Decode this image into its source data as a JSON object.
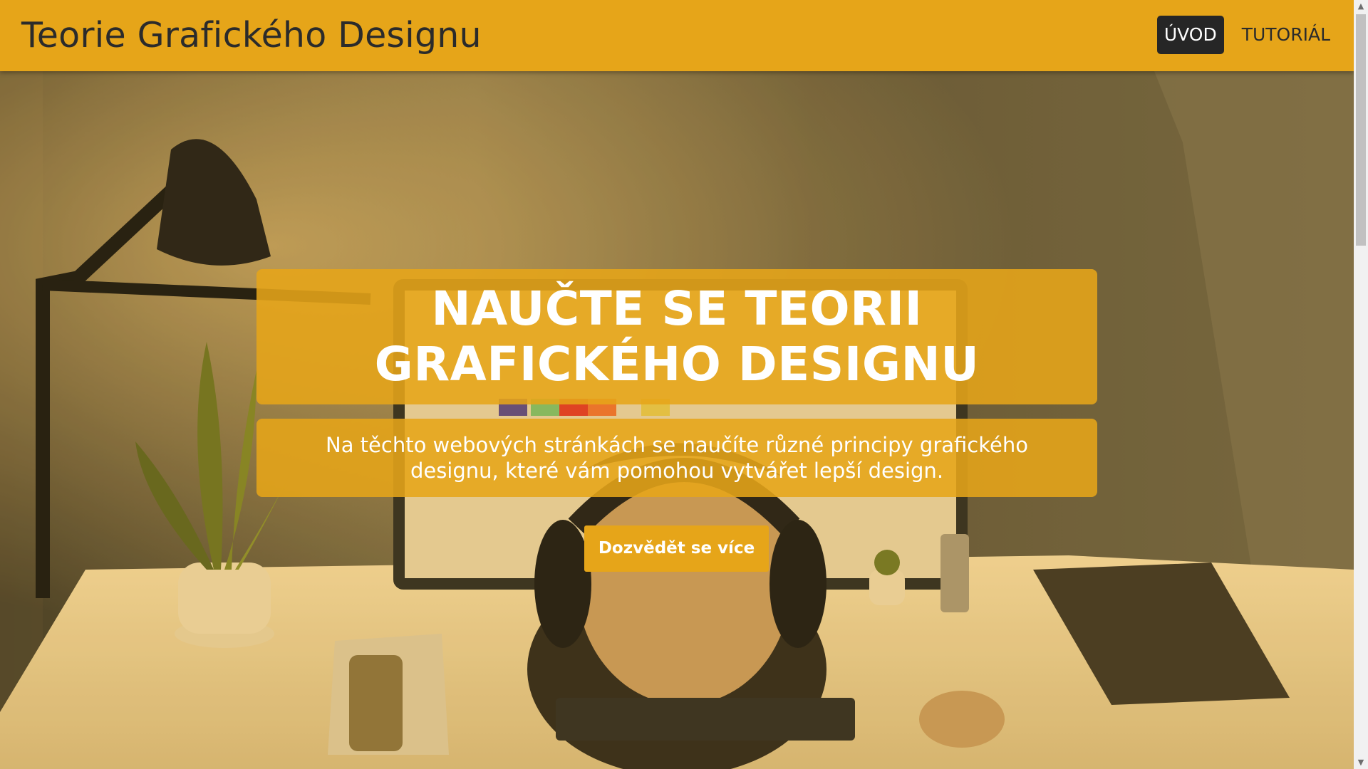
{
  "navbar": {
    "brand": "Teorie Grafického Designu",
    "items": [
      {
        "label": "ÚVOD",
        "active": true
      },
      {
        "label": "TUTORIÁL",
        "active": false
      }
    ]
  },
  "hero": {
    "title": "NAUČTE SE TEORII GRAFICKÉHO DESIGNU",
    "subtitle": "Na těchto webových stránkách se naučíte různé principy grafického designu, které vám pomohou vytvářet lepší design.",
    "cta_label": "Dozvědět se více",
    "background_image": "person-at-desk-with-monitor-photo"
  },
  "colors": {
    "accent": "#e6a519",
    "nav_active_bg": "#262626",
    "text_dark": "#2b2b2b",
    "text_light": "#ffffff"
  },
  "scrollbar": {
    "up_icon": "chevron-up-icon",
    "down_icon": "chevron-down-icon"
  }
}
